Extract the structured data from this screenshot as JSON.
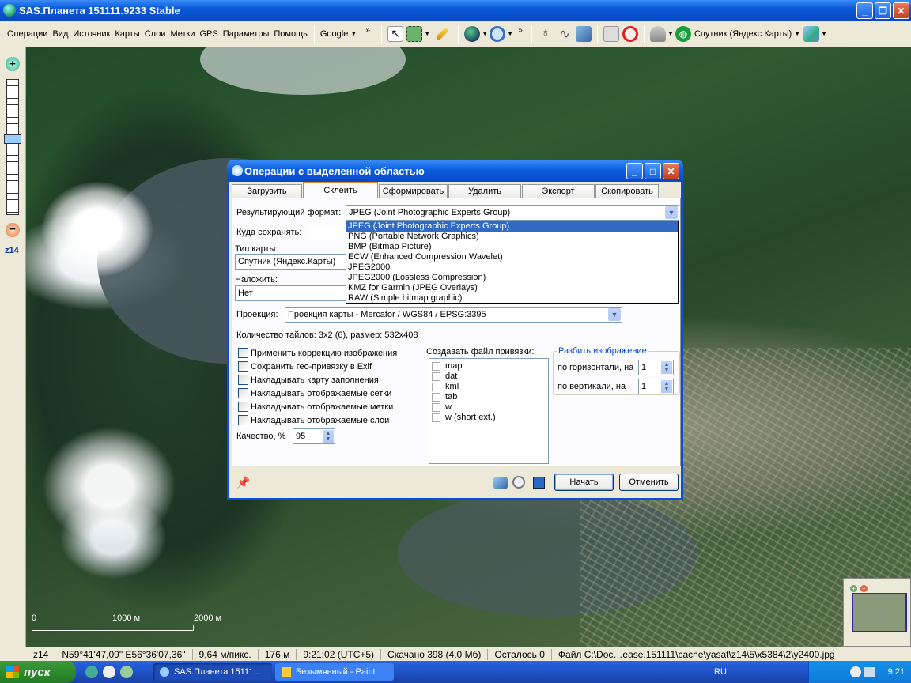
{
  "window": {
    "title": "SAS.Планета 151111.9233 Stable"
  },
  "menu": [
    "Операции",
    "Вид",
    "Источник",
    "Карты",
    "Слои",
    "Метки",
    "GPS",
    "Параметры",
    "Помощь"
  ],
  "toolbar": {
    "google_label": "Google",
    "map_label": "Спутник (Яндекс.Карты)"
  },
  "zoom_level": "z14",
  "scale": {
    "zero": "0",
    "mid": "1000 м",
    "end": "2000 м"
  },
  "status": {
    "zoom": "z14",
    "coords": "N59°41'47,09\" E56°36'07,36\"",
    "res": "9,64 м/пикс.",
    "dist": "176 м",
    "time": "9:21:02 (UTC+5)",
    "downloaded": "Скачано 398 (4,0 Мб)",
    "left": "Осталось 0",
    "file": "Файл C:\\Doc…ease.151111\\cache\\yasat\\z14\\5\\x5384\\2\\y2400.jpg"
  },
  "taskbar": {
    "start": "пуск",
    "tasks": [
      "SAS.Планета 15111...",
      "Безымянный - Paint"
    ],
    "lang": "RU",
    "clock": "9:21"
  },
  "dialog": {
    "title": "Операции с выделенной областью",
    "tabs": [
      "Загрузить",
      "Склеить",
      "Сформировать",
      "Удалить",
      "Экспорт",
      "Скопировать"
    ],
    "active_tab": "Склеить",
    "format_label": "Результирующий формат:",
    "format_value": "JPEG (Joint Photographic Experts Group)",
    "format_options": [
      "JPEG (Joint Photographic Experts Group)",
      "PNG (Portable Network Graphics)",
      "BMP (Bitmap Picture)",
      "ECW (Enhanced Compression Wavelet)",
      "JPEG2000",
      "JPEG2000 (Lossless Compression)",
      "KMZ for Garmin (JPEG Overlays)",
      "RAW (Simple bitmap graphic)"
    ],
    "save_label": "Куда сохранять:",
    "maptype_label": "Тип карты:",
    "maptype_value": "Спутник (Яндекс.Карты)",
    "overlay_label": "Наложить:",
    "overlay_value": "Нет",
    "projection_label": "Проекция:",
    "projection_value": "Проекция карты - Mercator / WGS84 / EPSG:3395",
    "tiles_info": "Количество тайлов: 3x2 (6), размер: 532x408",
    "checks": [
      "Применить коррекцию изображения",
      "Сохранить гео-привязку в Exif",
      "Накладывать карту заполнения",
      "Накладывать отображаемые сетки",
      "Накладывать отображаемые метки",
      "Накладывать отображаемые слои"
    ],
    "quality_label": "Качество, %",
    "quality_value": "95",
    "georef_label": "Создавать файл привязки:",
    "georef_options": [
      ".map",
      ".dat",
      ".kml",
      ".tab",
      ".w",
      ".w (short ext.)"
    ],
    "split_label": "Разбить изображение",
    "split_h_label": "по горизонтали, на",
    "split_h_value": "1",
    "split_v_label": "по вертикали, на",
    "split_v_value": "1",
    "start_button": "Начать",
    "cancel_button": "Отменить"
  }
}
